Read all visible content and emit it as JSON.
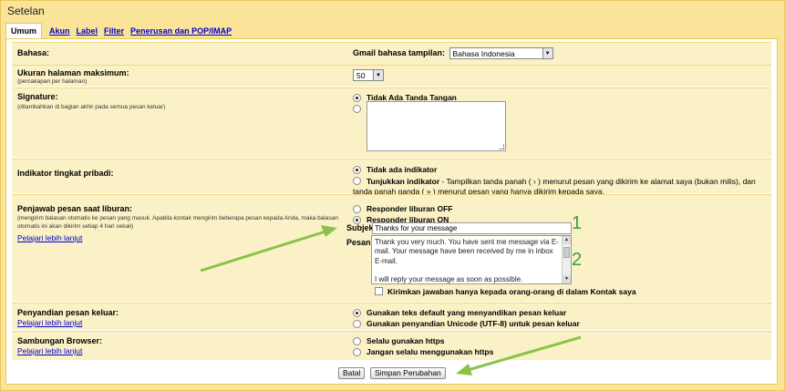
{
  "title": "Setelan",
  "tabs": [
    "Umum",
    "Akun",
    "Label",
    "Filter",
    "Penerusan dan POP/IMAP"
  ],
  "language": {
    "label": "Bahasa:",
    "display_label": "Gmail bahasa tampilan:",
    "value": "Bahasa Indonesia"
  },
  "page_size": {
    "label": "Ukuran halaman maksimum:",
    "sub": "(percakapan per halaman)",
    "value": "50"
  },
  "signature": {
    "label": "Signature:",
    "sub": "(ditambahkan di bagian akhir pada semua pesan keluar)",
    "opt_none": "Tidak Ada Tanda Tangan"
  },
  "indicator": {
    "label": "Indikator tingkat pribadi:",
    "opt1": "Tidak ada indikator",
    "opt2_bold": "Tunjukkan indikator",
    "opt2_desc": " - Tampilkan tanda panah ( › ) menurut pesan yang dikirim ke alamat saya (bukan milis), dan tanda panah ganda ( » ) menurut pesan yang hanya dikirim kepada saya."
  },
  "vacation": {
    "label": "Penjawab pesan saat liburan:",
    "sub": "(mengirim balasan otomatis ke pesan yang masuk. Apabila kontak mengirim beberapa pesan kepada Anda, maka balasan otomatis ini akan dikirim setiap 4 hari sekali)",
    "learn_more": "Pelajari lebih lanjut",
    "opt_off": "Responder liburan OFF",
    "opt_on": "Responder liburan ON",
    "subject_label": "Subjek:",
    "subject_value": "Thanks for your message",
    "message_label": "Pesan:",
    "message_line1": "Thank you very much. You have sent me message via E-mail. Your message have been received by me in inbox E-mail.",
    "message_line2": "I will reply your message as soon as possible.",
    "contacts_only": "Kirimkan jawaban hanya kepada orang-orang di dalam Kontak saya"
  },
  "encoding": {
    "label": "Penyandian pesan keluar:",
    "learn_more": "Pelajari lebih lanjut",
    "opt1": "Gunakan teks default yang menyandikan pesan keluar",
    "opt2": "Gunakan penyandian Unicode (UTF-8) untuk pesan keluar"
  },
  "browser": {
    "label": "Sambungan Browser:",
    "learn_more": "Pelajari lebih lanjut",
    "opt1": "Selalu gunakan https",
    "opt2": "Jangan selalu menggunakan https"
  },
  "buttons": {
    "cancel": "Batal",
    "save": "Simpan Perubahan"
  },
  "annotations": {
    "one": "1",
    "two": "2"
  },
  "colors": {
    "frame": "#f9e49a",
    "row": "#fbf1c6",
    "arrow": "#8bc34a",
    "annotation": "#3aa03a",
    "link": "#0000cc"
  }
}
